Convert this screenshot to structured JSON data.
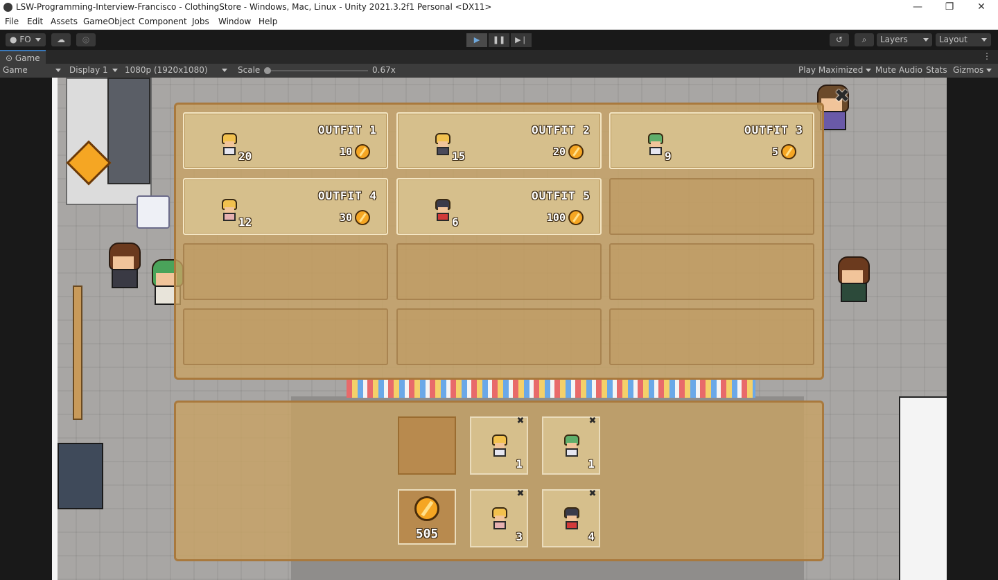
{
  "window": {
    "title": "LSW-Programming-Interview-Francisco - ClothingStore - Windows, Mac, Linux - Unity 2021.3.2f1 Personal <DX11>",
    "minimize": "—",
    "maximize": "❐",
    "close": "✕"
  },
  "menu": [
    "File",
    "Edit",
    "Assets",
    "GameObject",
    "Component",
    "Jobs",
    "Window",
    "Help"
  ],
  "toolbar": {
    "account": "FO",
    "layers": "Layers",
    "layout": "Layout",
    "play": "▶",
    "pause": "❚❚",
    "step": "▶❘"
  },
  "game_tab": {
    "label": "Game",
    "view": "Game",
    "display": "Display 1",
    "resolution": "1080p (1920x1080)",
    "scale_label": "Scale",
    "scale_value": "0.67x",
    "play_mode": "Play Maximized",
    "mute": "Mute Audio",
    "stats": "Stats",
    "gizmos": "Gizmos"
  },
  "shop": {
    "close": "✖",
    "items": [
      {
        "name": "OUTFIT 1",
        "stock": "20",
        "price": "10",
        "hat_color": "#f2c14e",
        "body_color": "#e6e6f0"
      },
      {
        "name": "OUTFIT 2",
        "stock": "15",
        "price": "20",
        "hat_color": "#f2c14e",
        "body_color": "#4a4a5a"
      },
      {
        "name": "OUTFIT 3",
        "stock": "9",
        "price": "5",
        "hat_color": "#5fae6b",
        "body_color": "#e6e6f0"
      },
      {
        "name": "OUTFIT 4",
        "stock": "12",
        "price": "30",
        "hat_color": "#f2c14e",
        "body_color": "#e6b0b0"
      },
      {
        "name": "OUTFIT 5",
        "stock": "6",
        "price": "100",
        "hat_color": "#3a3a4a",
        "body_color": "#d23a3a"
      }
    ]
  },
  "inventory": {
    "money": "505",
    "remove": "✖",
    "items": [
      {
        "qty": "1",
        "hat_color": "#f2c14e",
        "body_color": "#e6e6f0"
      },
      {
        "qty": "1",
        "hat_color": "#5fae6b",
        "body_color": "#e6e6f0"
      },
      {
        "qty": "3",
        "hat_color": "#f2c14e",
        "body_color": "#e6b0b0"
      },
      {
        "qty": "4",
        "hat_color": "#3a3a4a",
        "body_color": "#d23a3a"
      }
    ]
  }
}
